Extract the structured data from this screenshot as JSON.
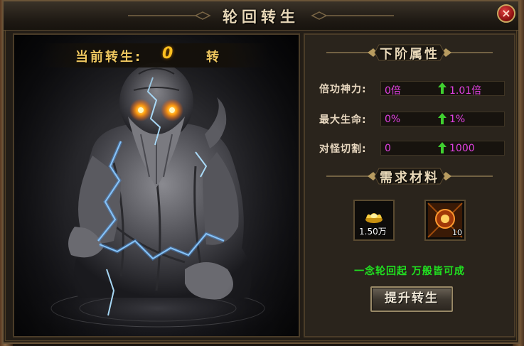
{
  "window": {
    "title": "轮回转生",
    "close_label": "×"
  },
  "left": {
    "current_label": "当前转生:",
    "current_value": "0",
    "current_unit": "转"
  },
  "next_attributes": {
    "title": "下阶属性",
    "rows": [
      {
        "label": "倍功神力:",
        "current": "0倍",
        "next": "1.01倍"
      },
      {
        "label": "最大生命:",
        "current": "0%",
        "next": "1%"
      },
      {
        "label": "对怪切割:",
        "current": "0",
        "next": "1000"
      }
    ]
  },
  "materials": {
    "title": "需求材料",
    "items": [
      {
        "icon": "gold-ingot-icon",
        "count": "1.50万"
      },
      {
        "icon": "rebirth-orb-icon",
        "count": "10"
      }
    ]
  },
  "slogan": "一念轮回起 万般皆可成",
  "action": {
    "upgrade_label": "提升转生"
  },
  "colors": {
    "accent_gold": "#f0c860",
    "value_magenta": "#e040e0",
    "slogan_green": "#20e020",
    "up_arrow_green": "#40d030"
  }
}
